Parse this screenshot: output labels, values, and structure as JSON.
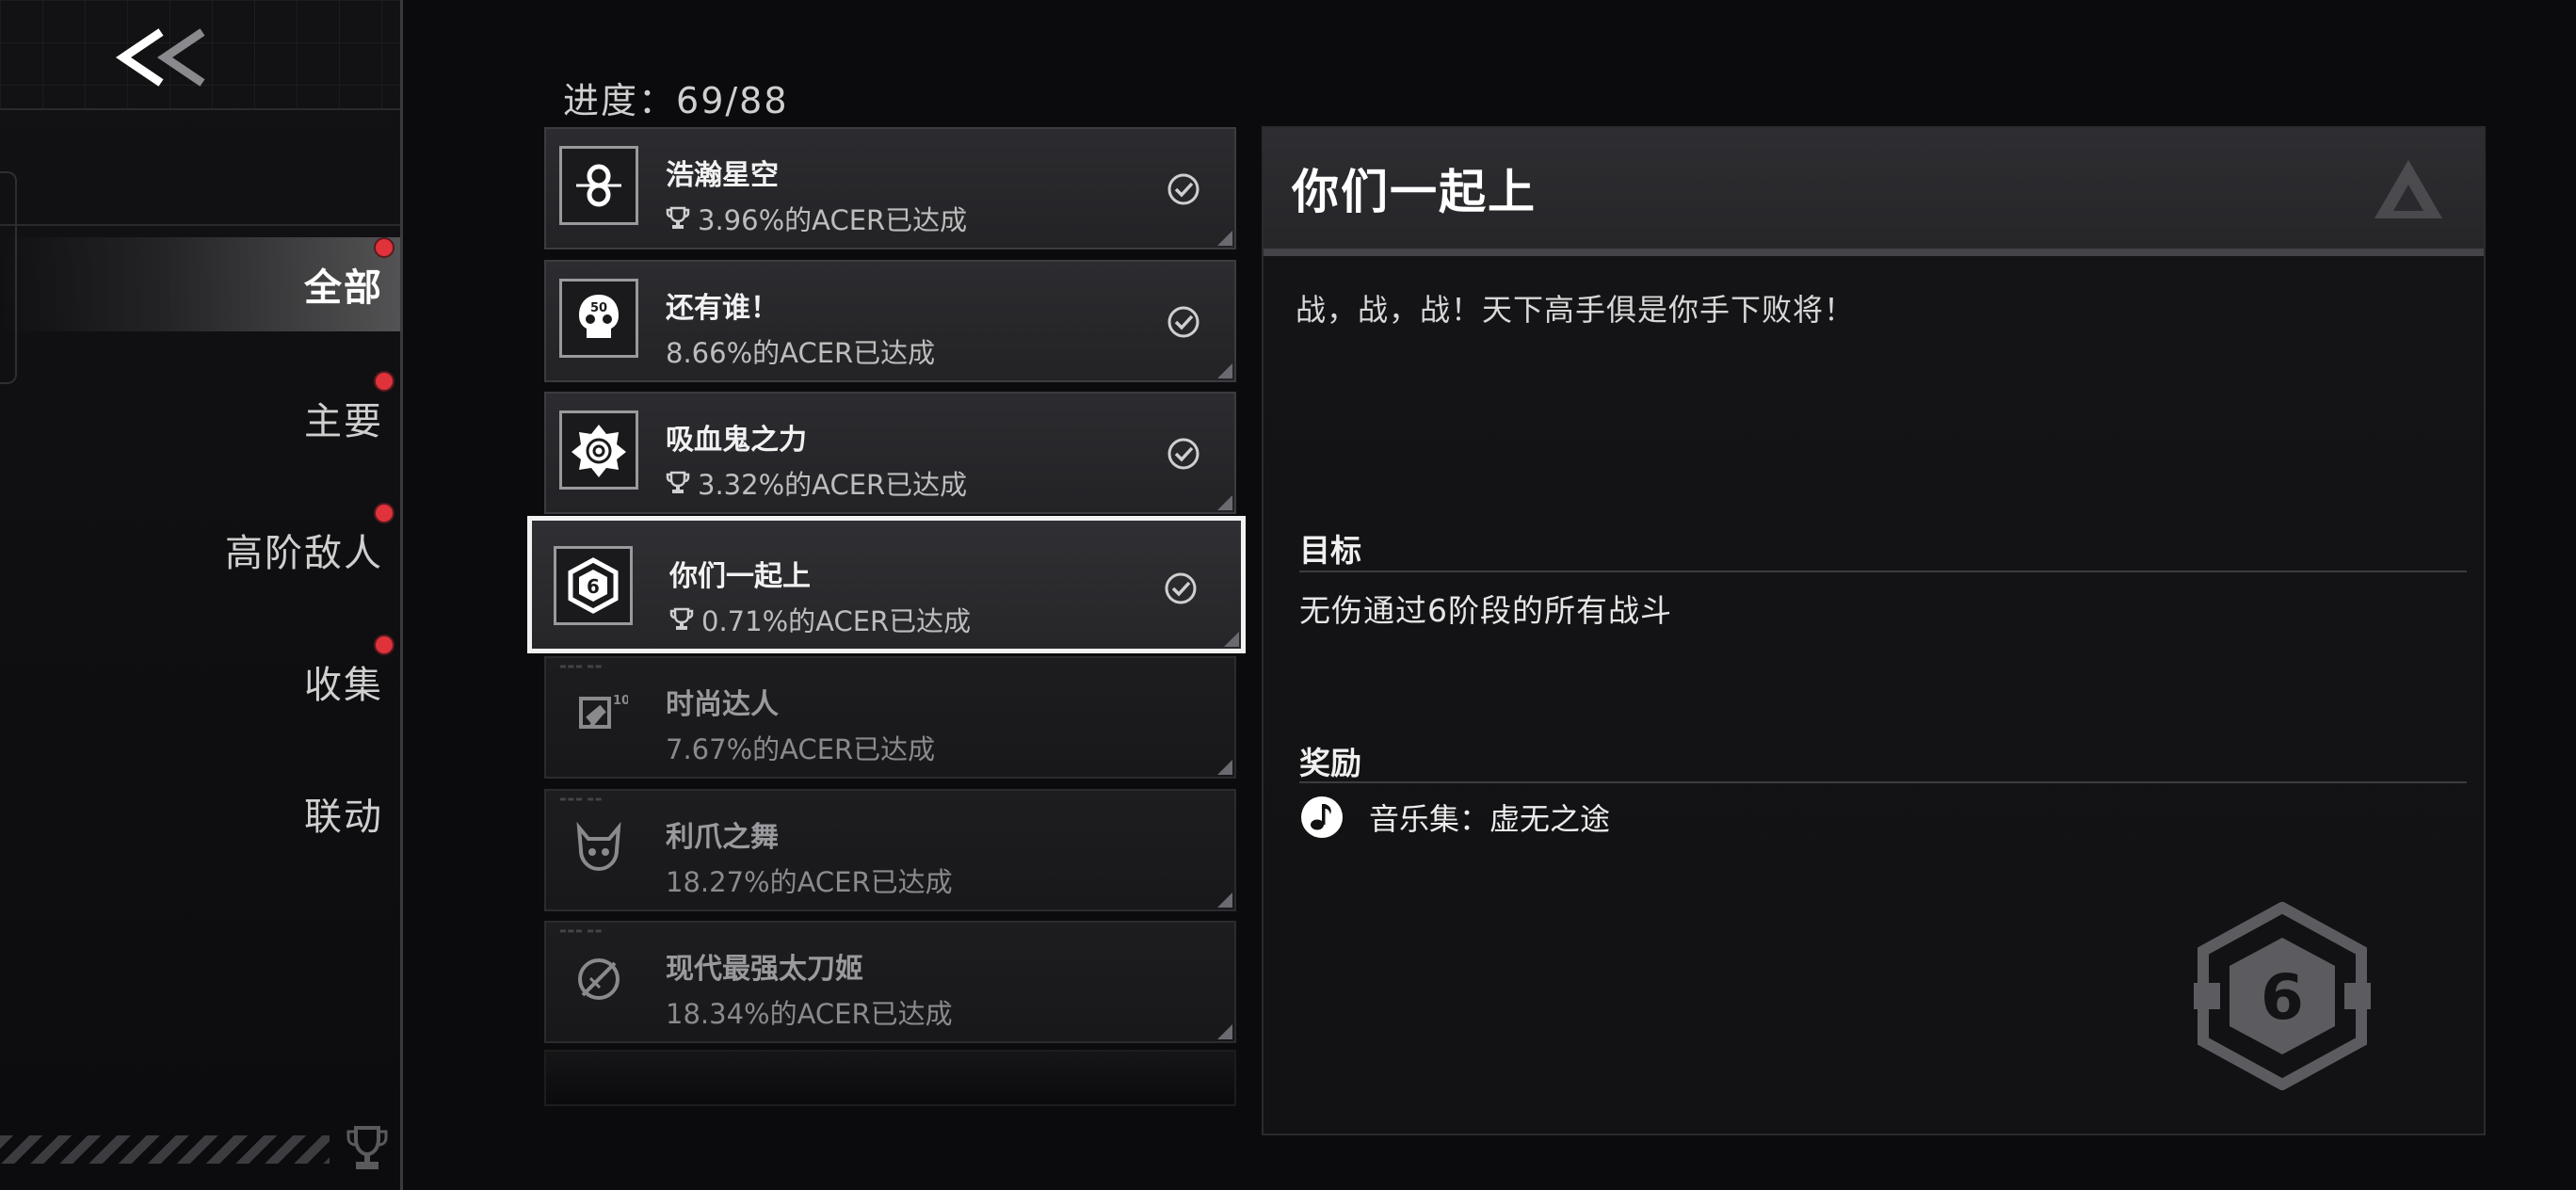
{
  "nav": {
    "back_icon": "double-chevron-left-icon",
    "items": [
      {
        "label": "全部",
        "active": true,
        "has_dot": true
      },
      {
        "label": "主要",
        "active": false,
        "has_dot": true
      },
      {
        "label": "高阶敌人",
        "active": false,
        "has_dot": true
      },
      {
        "label": "收集",
        "active": false,
        "has_dot": true
      },
      {
        "label": "联动",
        "active": false,
        "has_dot": false
      }
    ],
    "dot_color": "#e0323a"
  },
  "progress": {
    "label": "进度：",
    "value": "69/88"
  },
  "achievements": [
    {
      "title": "浩瀚星空",
      "rate": "3.96%的ACER已达成",
      "icon": "infinity-orbit-icon",
      "completed": true
    },
    {
      "title": "还有谁！",
      "rate": "8.66%的ACER已达成",
      "icon": "skull-50-icon",
      "completed": true
    },
    {
      "title": "吸血鬼之力",
      "rate": "3.32%的ACER已达成",
      "icon": "rose-icon",
      "completed": true
    },
    {
      "title": "你们一起上",
      "rate": "0.71%的ACER已达成",
      "icon": "hexagon-6-icon",
      "completed": true,
      "selected": true
    },
    {
      "title": "时尚达人",
      "rate": "7.67%的ACER已达成",
      "icon": "hammer-10-icon",
      "completed": false
    },
    {
      "title": "利爪之舞",
      "rate": "18.27%的ACER已达成",
      "icon": "cat-face-icon",
      "completed": false
    },
    {
      "title": "现代最强太刀姬",
      "rate": "18.34%的ACER已达成",
      "icon": "sword-circle-icon",
      "completed": false
    }
  ],
  "detail": {
    "title": "你们一起上",
    "description": "战，战，战！天下高手俱是你手下败将！",
    "goal_label": "目标",
    "goal_text": "无伤通过6阶段的所有战斗",
    "reward_label": "奖励",
    "reward_text": "音乐集：虚无之途",
    "reward_icon": "music-note-icon",
    "badge_icon": "hexagon-6-icon"
  }
}
